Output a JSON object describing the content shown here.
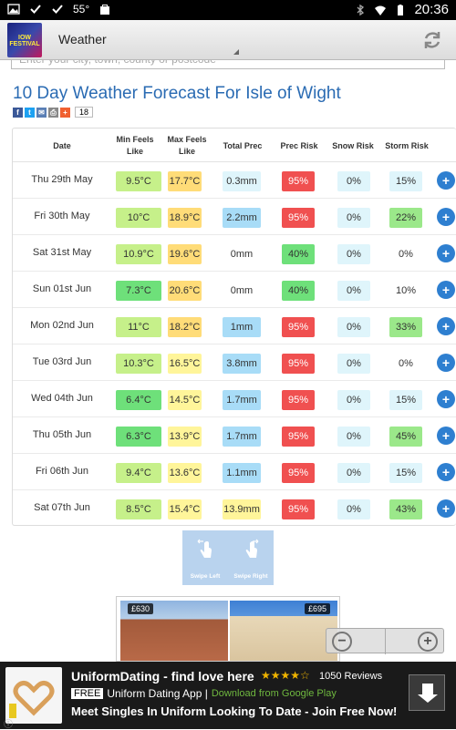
{
  "status_bar": {
    "temperature": "55°",
    "time": "20:36"
  },
  "action_bar": {
    "title": "Weather",
    "app_icon_text": "IOW FESTIVAL"
  },
  "search": {
    "placeholder": "Enter your city, town, county or postcode"
  },
  "page": {
    "title": "10 Day Weather Forecast For Isle of Wight",
    "share_count": "18"
  },
  "table": {
    "headers": {
      "date": "Date",
      "min": "Min Feels Like",
      "max": "Max Feels Like",
      "prec": "Total Prec",
      "prec_risk": "Prec Risk",
      "snow_risk": "Snow Risk",
      "storm_risk": "Storm Risk"
    },
    "rows": [
      {
        "date": "Thu 29th May",
        "min": "9.5°C",
        "max": "17.7°C",
        "prec": "0.3mm",
        "prec_risk": "95%",
        "snow": "0%",
        "storm": "15%"
      },
      {
        "date": "Fri 30th May",
        "min": "10°C",
        "max": "18.9°C",
        "prec": "2.2mm",
        "prec_risk": "95%",
        "snow": "0%",
        "storm": "22%"
      },
      {
        "date": "Sat 31st May",
        "min": "10.9°C",
        "max": "19.6°C",
        "prec": "0mm",
        "prec_risk": "40%",
        "snow": "0%",
        "storm": "0%"
      },
      {
        "date": "Sun 01st Jun",
        "min": "7.3°C",
        "max": "20.6°C",
        "prec": "0mm",
        "prec_risk": "40%",
        "snow": "0%",
        "storm": "10%"
      },
      {
        "date": "Mon 02nd Jun",
        "min": "11°C",
        "max": "18.2°C",
        "prec": "1mm",
        "prec_risk": "95%",
        "snow": "0%",
        "storm": "33%"
      },
      {
        "date": "Tue 03rd Jun",
        "min": "10.3°C",
        "max": "16.5°C",
        "prec": "3.8mm",
        "prec_risk": "95%",
        "snow": "0%",
        "storm": "0%"
      },
      {
        "date": "Wed 04th Jun",
        "min": "6.4°C",
        "max": "14.5°C",
        "prec": "1.7mm",
        "prec_risk": "95%",
        "snow": "0%",
        "storm": "15%"
      },
      {
        "date": "Thu 05th Jun",
        "min": "6.3°C",
        "max": "13.9°C",
        "prec": "1.7mm",
        "prec_risk": "95%",
        "snow": "0%",
        "storm": "45%"
      },
      {
        "date": "Fri 06th Jun",
        "min": "9.4°C",
        "max": "13.6°C",
        "prec": "1.1mm",
        "prec_risk": "95%",
        "snow": "0%",
        "storm": "15%"
      },
      {
        "date": "Sat 07th Jun",
        "min": "8.5°C",
        "max": "15.4°C",
        "prec": "13.9mm",
        "prec_risk": "95%",
        "snow": "0%",
        "storm": "43%"
      }
    ]
  },
  "swipe": {
    "left_label": "Swipe Left",
    "right_label": "Swipe Right"
  },
  "listings": {
    "price1": "£630",
    "price2": "£695"
  },
  "ad": {
    "title": "UniformDating - find love here",
    "stars": "★★★★☆",
    "reviews": "1050 Reviews",
    "free": "FREE",
    "app_name": "Uniform Dating App |",
    "store": "Download from Google Play",
    "description": "Meet Singles In Uniform Looking To Date - Join Free Now!"
  },
  "colors": {
    "min_green": "#c6f08a",
    "min_green_dark": "#6ee07a",
    "max_orange": "#ffdc78",
    "max_yellow": "#fff59a",
    "prec_blue": "#a8dcf7",
    "prec_light": "#dff5fb",
    "risk_red": "#f05050",
    "risk_green": "#6ee07a",
    "storm_light": "#dff5fb",
    "storm_green": "#9be88a"
  }
}
